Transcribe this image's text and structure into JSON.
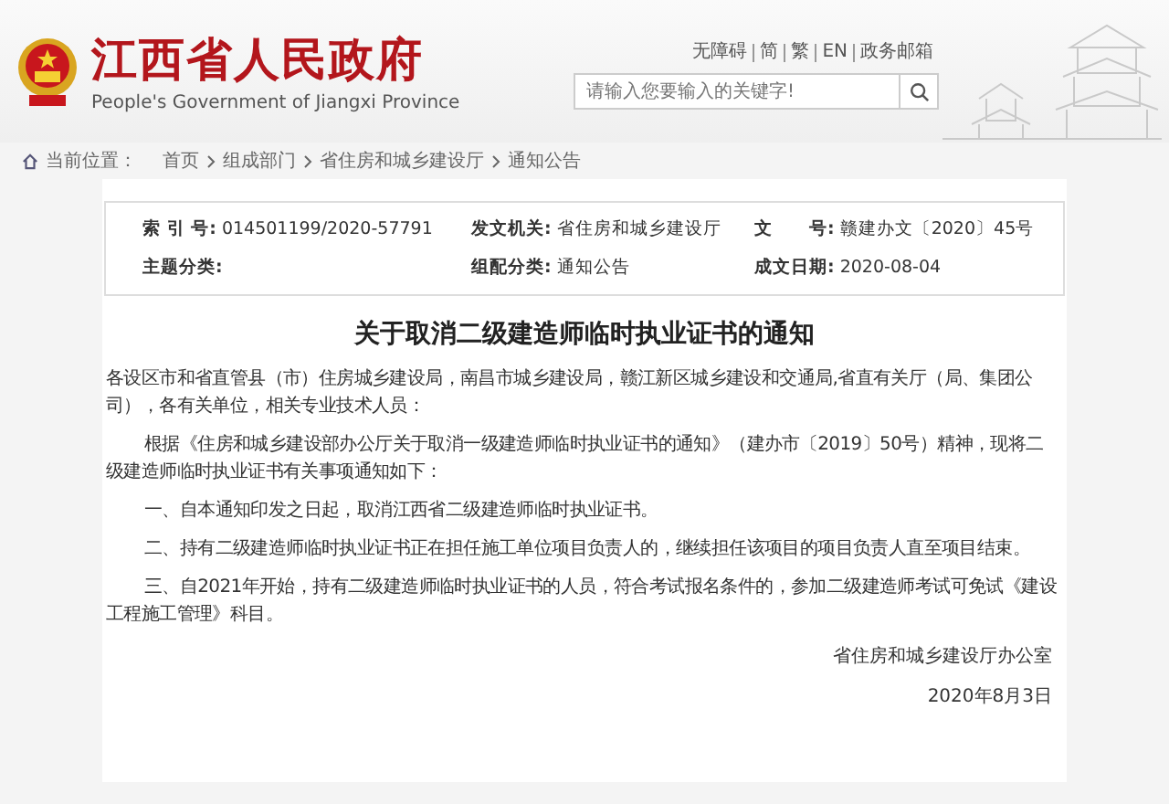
{
  "header": {
    "title": "江西省人民政府",
    "subtitle": "People's Government of Jiangxi Province",
    "links": [
      "无障碍",
      "简",
      "繁",
      "EN",
      "政务邮箱"
    ],
    "search": {
      "placeholder": "请输入您要输入的关键字!"
    }
  },
  "breadcrumb": {
    "label": "当前位置：",
    "items": [
      "首页",
      "组成部门",
      "省住房和城乡建设厅",
      "通知公告"
    ]
  },
  "meta": [
    {
      "label": "索 引 号:",
      "value": "014501199/2020-57791"
    },
    {
      "label": "发文机关:",
      "value": "省住房和城乡建设厅"
    },
    {
      "label": "文　　号:",
      "value": "赣建办文〔2020〕45号"
    },
    {
      "label": "主题分类:"
    },
    {
      "label": "组配分类:",
      "value": "通知公告"
    },
    {
      "label": "成文日期:",
      "value": "2020-08-04"
    }
  ],
  "article": {
    "title": "关于取消二级建造师临时执业证书的通知",
    "salutation": "各设区市和省直管县（市）住房城乡建设局，南昌市城乡建设局，赣江新区城乡建设和交通局,省直有关厅（局、集团公司），各有关单位，相关专业技术人员：",
    "paragraphs": [
      "根据《住房和城乡建设部办公厅关于取消一级建造师临时执业证书的通知》（建办市〔2019〕50号）精神，现将二级建造师临时执业证书有关事项通知如下：",
      "一、自本通知印发之日起，取消江西省二级建造师临时执业证书。",
      "二、持有二级建造师临时执业证书正在担任施工单位项目负责人的，继续担任该项目的项目负责人直至项目结束。",
      "三、自2021年开始，持有二级建造师临时执业证书的人员，符合考试报名条件的，参加二级建造师考试可免试《建设工程施工管理》科目。"
    ],
    "signature": "省住房和城乡建设厅办公室",
    "date": "2020年8月3日"
  }
}
